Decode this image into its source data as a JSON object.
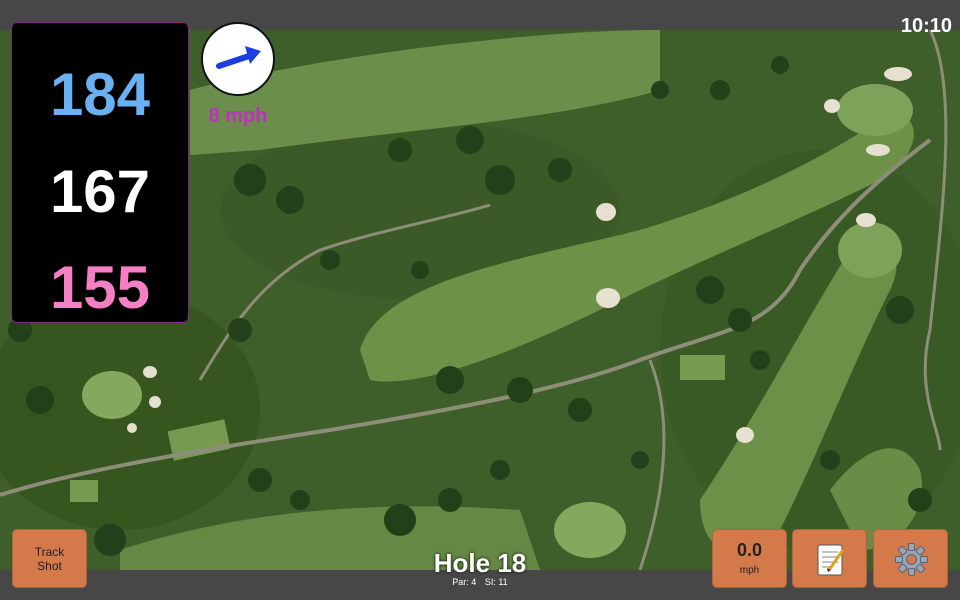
{
  "status": {
    "clock": "10:10"
  },
  "distances": {
    "back": "184",
    "middle": "167",
    "front": "155"
  },
  "wind": {
    "speed": "8 mph",
    "icon": "wind-arrow-icon"
  },
  "hole": {
    "title": "Hole 18",
    "par": "Par: 4",
    "stroke_index": "SI: 11"
  },
  "buttons": {
    "track_shot": "Track\nShot",
    "speed_value": "0.0",
    "speed_unit": "mph",
    "notes_icon": "notepad-icon",
    "settings_icon": "gear-icon"
  },
  "colors": {
    "back": "#6ab0f3",
    "middle": "#ffffff",
    "front": "#f57fc4",
    "wind_text": "#c02fc0",
    "button": "#d47a4a"
  }
}
